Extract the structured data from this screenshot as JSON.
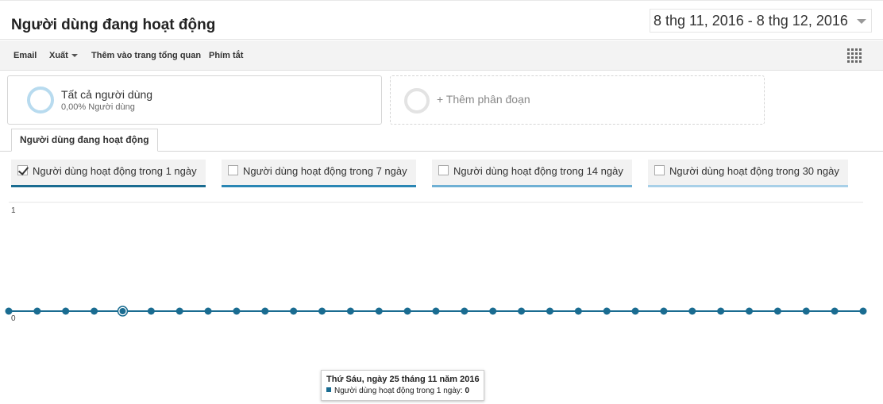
{
  "header": {
    "title": "Người dùng đang hoạt động",
    "date_range": "8 thg 11, 2016 - 8 thg 12, 2016"
  },
  "toolbar": {
    "email": "Email",
    "export": "Xuất",
    "add_dashboard": "Thêm vào trang tổng quan",
    "shortcut": "Phím tắt",
    "grid_icon": "grid-icon"
  },
  "segments": {
    "active": {
      "title": "Tất cả người dùng",
      "subtitle": "0,00% Người dùng",
      "ring_color": "#b8dbef"
    },
    "add": {
      "label": "+ Thêm phân đoạn"
    }
  },
  "tab": {
    "label": "Người dùng đang hoạt động"
  },
  "metrics": [
    {
      "label": "Người dùng hoạt động trong 1 ngày",
      "checked": true,
      "color": "#1a6c91"
    },
    {
      "label": "Người dùng hoạt động trong 7 ngày",
      "checked": false,
      "color": "#2a86b4"
    },
    {
      "label": "Người dùng hoạt động trong 14 ngày",
      "checked": false,
      "color": "#6fb0d4"
    },
    {
      "label": "Người dùng hoạt động trong 30 ngày",
      "checked": false,
      "color": "#a8d0e8"
    }
  ],
  "chart_data": {
    "type": "line",
    "series": [
      {
        "name": "Người dùng hoạt động trong 1 ngày",
        "color": "#1a6c91",
        "values": [
          0,
          0,
          0,
          0,
          0,
          0,
          0,
          0,
          0,
          0,
          0,
          0,
          0,
          0,
          0,
          0,
          0,
          0,
          0,
          0,
          0,
          0,
          0,
          0,
          0,
          0,
          0,
          0,
          0,
          0,
          0
        ]
      }
    ],
    "ylim": [
      0,
      1
    ],
    "y_ticks": [
      "1",
      "0"
    ],
    "grid": true,
    "highlighted_index": 4
  },
  "tooltip": {
    "title": "Thứ Sáu, ngày 25 tháng 11 năm 2016",
    "series_label": "Người dùng hoạt động trong 1 ngày:",
    "value": "0"
  }
}
